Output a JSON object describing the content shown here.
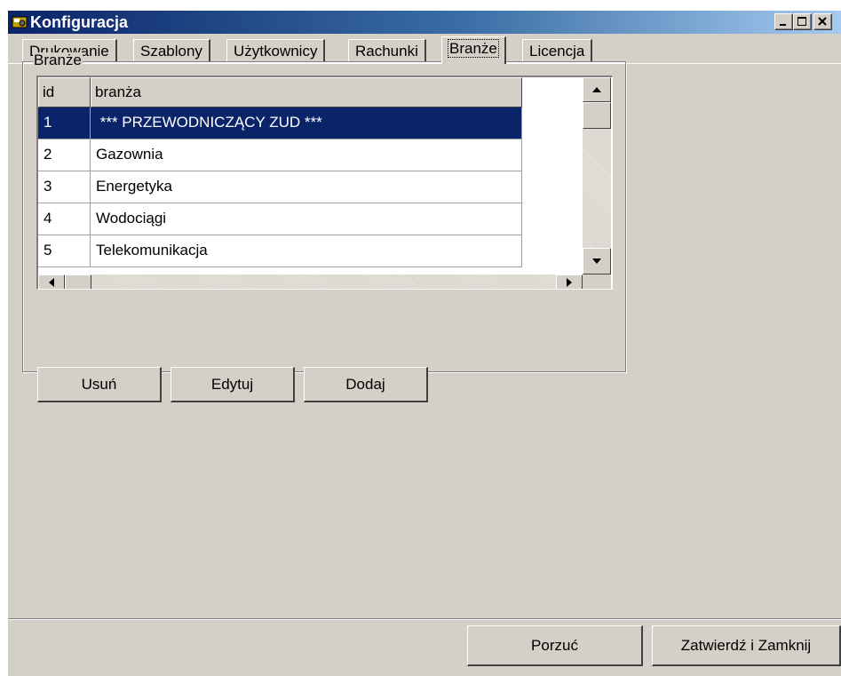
{
  "window": {
    "title": "Konfiguracja",
    "icon": "app-config-icon",
    "controls": [
      "minimize-icon",
      "maximize-icon",
      "close-icon"
    ]
  },
  "tabs": [
    {
      "label": "Drukowanie",
      "active": false
    },
    {
      "label": "Szablony",
      "active": false
    },
    {
      "label": "Użytkownicy",
      "active": false
    },
    {
      "label": "Rachunki",
      "active": false
    },
    {
      "label": "Branże",
      "active": true
    },
    {
      "label": "Licencja",
      "active": false
    }
  ],
  "group": {
    "label": "Branże",
    "grid": {
      "columns": [
        "id",
        "branża"
      ],
      "rows": [
        {
          "id": "1",
          "name": " *** PRZEWODNICZĄCY ZUD ***",
          "selected": true
        },
        {
          "id": "2",
          "name": "Gazownia",
          "selected": false
        },
        {
          "id": "3",
          "name": "Energetyka",
          "selected": false
        },
        {
          "id": "4",
          "name": "Wodociągi",
          "selected": false
        },
        {
          "id": "5",
          "name": "Telekomunikacja",
          "selected": false
        }
      ]
    },
    "buttons": {
      "delete": "Usuń",
      "edit": "Edytuj",
      "add": "Dodaj"
    }
  },
  "footer": {
    "cancel": "Porzuć",
    "confirm": "Zatwierdź i Zamknij"
  },
  "colors": {
    "face": "#d4d0c8",
    "selection": "#0a246a",
    "title_start": "#0a246a",
    "title_end": "#a6caf0"
  }
}
